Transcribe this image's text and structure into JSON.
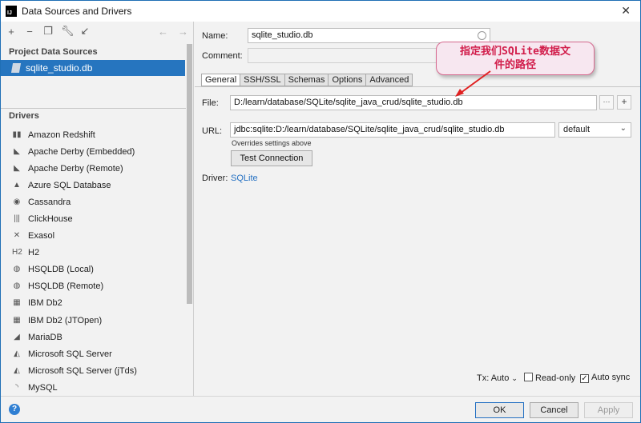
{
  "window": {
    "title": "Data Sources and Drivers",
    "app_icon_text": "IJ"
  },
  "left": {
    "project_section": "Project Data Sources",
    "data_source": "sqlite_studio.db",
    "drivers_section": "Drivers",
    "drivers": [
      {
        "label": "Amazon Redshift",
        "icon": "redshift-icon",
        "glyph": "▮▮"
      },
      {
        "label": "Apache Derby (Embedded)",
        "icon": "derby-icon",
        "glyph": "◣"
      },
      {
        "label": "Apache Derby (Remote)",
        "icon": "derby-icon",
        "glyph": "◣"
      },
      {
        "label": "Azure SQL Database",
        "icon": "azure-icon",
        "glyph": "▲"
      },
      {
        "label": "Cassandra",
        "icon": "cassandra-icon",
        "glyph": "◉"
      },
      {
        "label": "ClickHouse",
        "icon": "clickhouse-icon",
        "glyph": "|||"
      },
      {
        "label": "Exasol",
        "icon": "exasol-icon",
        "glyph": "✕"
      },
      {
        "label": "H2",
        "icon": "h2-icon",
        "glyph": "H2"
      },
      {
        "label": "HSQLDB (Local)",
        "icon": "hsqldb-icon",
        "glyph": "◍"
      },
      {
        "label": "HSQLDB (Remote)",
        "icon": "hsqldb-icon",
        "glyph": "◍"
      },
      {
        "label": "IBM Db2",
        "icon": "ibm-icon",
        "glyph": "▦"
      },
      {
        "label": "IBM Db2 (JTOpen)",
        "icon": "ibm-icon",
        "glyph": "▦"
      },
      {
        "label": "MariaDB",
        "icon": "mariadb-icon",
        "glyph": "◢"
      },
      {
        "label": "Microsoft SQL Server",
        "icon": "mssql-icon",
        "glyph": "◭"
      },
      {
        "label": "Microsoft SQL Server (jTds)",
        "icon": "mssql-icon",
        "glyph": "◭"
      },
      {
        "label": "MySQL",
        "icon": "mysql-icon",
        "glyph": "◝"
      }
    ]
  },
  "form": {
    "name_label": "Name:",
    "name_value": "sqlite_studio.db",
    "comment_label": "Comment:",
    "comment_value": "",
    "tabs": [
      "General",
      "SSH/SSL",
      "Schemas",
      "Options",
      "Advanced"
    ],
    "file_label": "File:",
    "file_value": "D:/learn/database/SQLite/sqlite_java_crud/sqlite_studio.db",
    "file_browse": "···",
    "file_add": "+",
    "url_label": "URL:",
    "url_value": "jdbc:sqlite:D:/learn/database/SQLite/sqlite_java_crud/sqlite_studio.db",
    "url_mode": "default",
    "url_hint": "Overrides settings above",
    "test_connection": "Test Connection",
    "driver_label": "Driver:",
    "driver_value": "SQLite",
    "tx_label": "Tx: Auto",
    "read_only": "Read-only",
    "auto_sync": "Auto sync"
  },
  "callout": {
    "line1": "指定我们SQLite数据文",
    "line2": "件的路径"
  },
  "buttons": {
    "ok": "OK",
    "cancel": "Cancel",
    "apply": "Apply",
    "help": "?"
  },
  "colors": {
    "accent": "#2675bf",
    "link": "#2470c2",
    "callout_text": "#d11c4a"
  }
}
